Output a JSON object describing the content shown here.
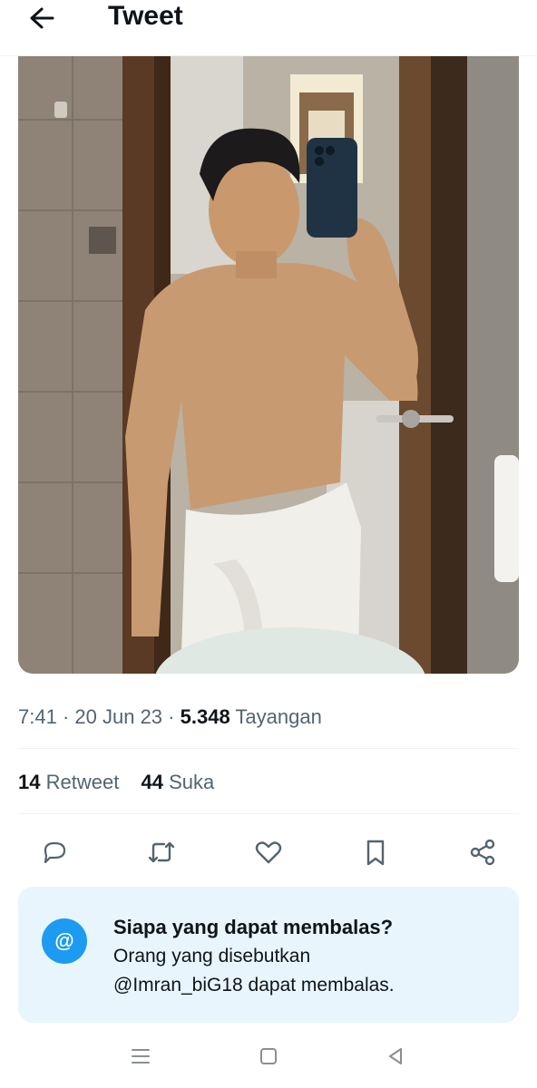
{
  "header": {
    "title": "Tweet",
    "back_icon": "arrow-left-icon"
  },
  "media": {
    "kind": "photo",
    "subject": "mirror selfie"
  },
  "meta": {
    "time": "7:41",
    "date": "20 Jun 23",
    "separator": "·",
    "views_count": "5.348",
    "views_label": "Tayangan"
  },
  "stats": {
    "retweets_count": "14",
    "retweets_label": "Retweet",
    "likes_count": "44",
    "likes_label": "Suka"
  },
  "actions": [
    {
      "name": "reply",
      "icon": "speech-bubble-icon"
    },
    {
      "name": "retweet",
      "icon": "retweet-icon"
    },
    {
      "name": "like",
      "icon": "heart-icon"
    },
    {
      "name": "bookmark",
      "icon": "bookmark-icon"
    },
    {
      "name": "share",
      "icon": "share-icon"
    }
  ],
  "reply_restriction": {
    "badge": "@",
    "title": "Siapa yang dapat membalas?",
    "line1": "Orang yang disebutkan",
    "line2": "@Imran_biG18 dapat membalas."
  },
  "system_nav": {
    "items": [
      "menu-icon",
      "home-square-icon",
      "back-triangle-icon"
    ]
  },
  "colors": {
    "accent": "#1d9bf0",
    "text_primary": "#0f1419",
    "text_secondary": "#536471",
    "reply_card_bg": "#e8f5fd"
  }
}
